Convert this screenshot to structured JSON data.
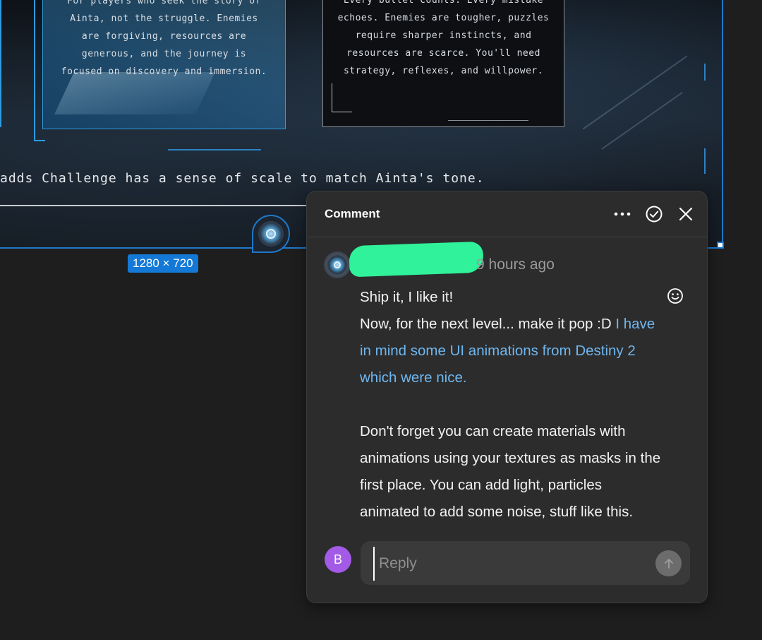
{
  "canvas": {
    "card_story_text": "For players who seek the story of Ainta, not the struggle. Enemies are forgiving, resources are generous, and the journey is focused on discovery and immersion.",
    "card_challenge_text": "Every bullet counts. Every mistake echoes. Enemies are tougher, puzzles require sharper instincts, and resources are scarce. You'll need strategy, reflexes, and willpower.",
    "tagline": "adds Challenge has a sense of scale to match Ainta's tone.",
    "size_badge": "1280 × 720",
    "accent_color": "#1e78c8"
  },
  "comment": {
    "title": "Comment",
    "more_icon": "more-horizontal-icon",
    "resolve_icon": "check-circle-icon",
    "close_icon": "close-icon",
    "timestamp": "9 hours ago",
    "body": {
      "line1": "Ship it, I like it!",
      "line2_plain": "Now, for the next level... make it pop :D ",
      "line2_link": "I have in mind some UI animations from Destiny 2 which were nice.",
      "paragraph2": "Don't forget you can create materials with animations using your textures as masks in the first place. You can add light, particles animated to add some noise, stuff like this."
    },
    "link_color": "#6fb6ef",
    "emoji_icon": "smiley-icon",
    "reply": {
      "avatar_initial": "B",
      "avatar_color": "#a35ae6",
      "placeholder": "Reply",
      "value": "",
      "send_icon": "arrow-up-icon"
    }
  }
}
